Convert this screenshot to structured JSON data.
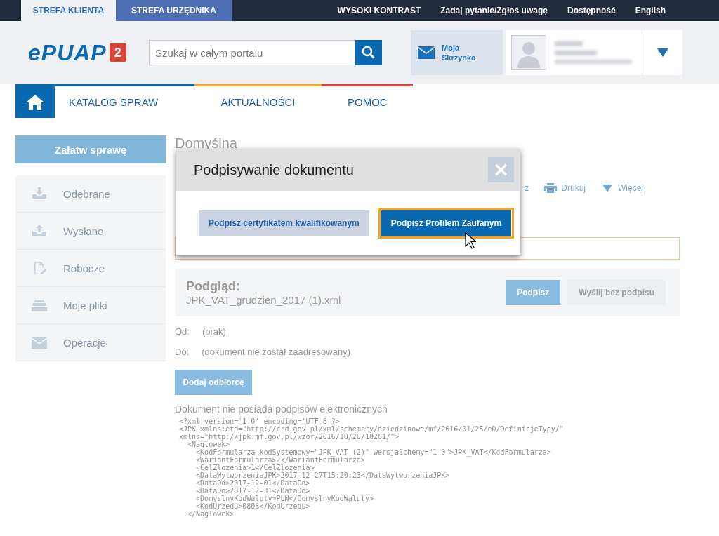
{
  "top_bar": {
    "tabs": [
      {
        "label": "STREFA KLIENTA",
        "selected": true
      },
      {
        "label": "STREFA URZĘDNIKA",
        "selected": false
      }
    ],
    "links": [
      "WYSOKI KONTRAST",
      "Zadaj pytanie/Zgłoś uwagę",
      "Dostępność",
      "English"
    ]
  },
  "header": {
    "logo": {
      "text": "ePUAP",
      "badge": "2"
    },
    "search": {
      "placeholder": "Szukaj w całym portalu"
    },
    "mailbox": "Moja Skrzynka"
  },
  "nav": {
    "items": [
      {
        "label": "KATALOG SPRAW",
        "color": "#0a6ab1"
      },
      {
        "label": "AKTUALNOŚCI",
        "color": "#f5a623"
      },
      {
        "label": "POMOC",
        "color": "#d9453a"
      }
    ]
  },
  "sidebar": {
    "action": "Załatw sprawę",
    "items": [
      {
        "label": "Odebrane",
        "kind": "download"
      },
      {
        "label": "Wysłane",
        "kind": "upload"
      },
      {
        "label": "Robocze",
        "kind": "draft"
      },
      {
        "label": "Moje pliki",
        "kind": "tray"
      },
      {
        "label": "Operacje",
        "kind": "mail"
      }
    ]
  },
  "main": {
    "heading": "Domyślna",
    "toolbar": [
      {
        "label": "z",
        "kind": "text"
      },
      {
        "label": "Drukuj",
        "kind": "print"
      },
      {
        "label": "Więcej",
        "kind": "more"
      }
    ],
    "preview": {
      "title": "Podgląd:",
      "file": "JPK_VAT_grudzien_2017 (1).xml",
      "buttons": [
        {
          "label": "Podpisz",
          "disabled": false
        },
        {
          "label": "Wyślij bez podpisu",
          "disabled": true
        }
      ]
    },
    "from": {
      "label": "Od:",
      "value": "(brak)"
    },
    "to": {
      "label": "Do:",
      "value": "(dokument nie został zaadresowany)"
    },
    "add_recipient": "Dodaj odbiorcę",
    "signature_note": "Dokument nie posiada podpisów elektronicznych",
    "code": [
      "<?xml version='1.0' encoding='UTF-8'?>",
      "<JPK xmlns:etd=\"http://crd.gov.pl/xml/schematy/dziedzinowe/mf/2016/01/25/eD/DefinicjeTypy/\"",
      "xmlns=\"http://jpk.mf.gov.pl/wzor/2016/10/26/10261/\">",
      "  <Naglowek>",
      "    <KodFormularza kodSystemowy=\"JPK_VAT (2)\" wersjaSchemy=\"1-0\">JPK_VAT</KodFormularza>",
      "    <WariantFormularza>2</WariantFormularza>",
      "    <CelZlozenia>1</CelZlozenia>",
      "    <DataWytworzeniaJPK>2017-12-27T15:20:23</DataWytworzeniaJPK>",
      "    <DataOd>2017-12-01</DataOd>",
      "    <DataDo>2017-12-31</DataDo>",
      "    <DomyslnyKodWaluty>PLN</DomyslnyKodWaluty>",
      "    <KodUrzedu>0808</KodUrzedu>",
      "  </Naglowek>"
    ]
  },
  "dialog": {
    "title": "Podpisywanie dokumentu",
    "close": "×",
    "buttons": [
      {
        "label": "Podpisz certyfikatem kwalifikowanym",
        "focused": false
      },
      {
        "label": "Podpisz Profilem Zaufanym",
        "focused": true
      }
    ]
  }
}
